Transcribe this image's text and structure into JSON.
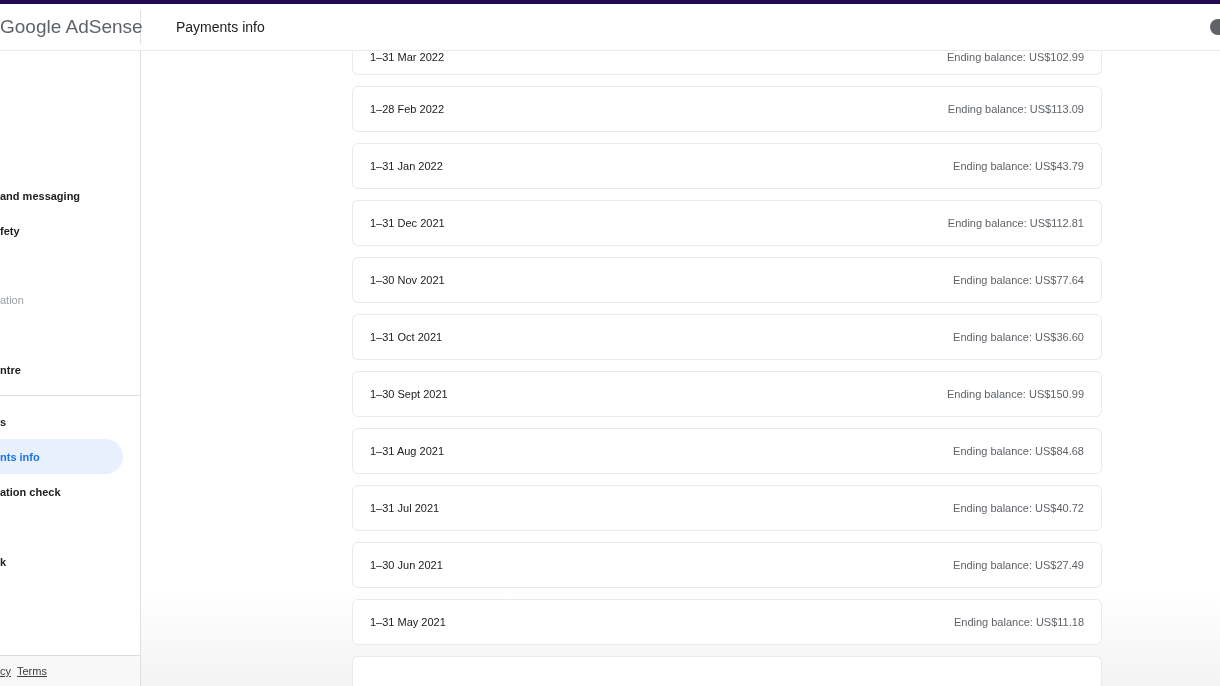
{
  "header": {
    "logo": "Google AdSense",
    "title": "Payments info"
  },
  "sidebar": {
    "groups": [
      {
        "items": [
          {
            "label": "and messaging",
            "kind": "link",
            "selected": false
          },
          {
            "label": "fety",
            "kind": "link",
            "selected": false
          },
          {
            "label": "ation",
            "kind": "heading",
            "selected": false
          },
          {
            "label": "ntre",
            "kind": "link",
            "selected": false
          }
        ]
      },
      {
        "items": [
          {
            "label": "s",
            "kind": "link",
            "selected": false
          },
          {
            "label": "nts info",
            "kind": "link",
            "selected": true
          },
          {
            "label": "ation check",
            "kind": "link",
            "selected": false
          },
          {
            "label": "k",
            "kind": "link",
            "selected": false
          }
        ]
      }
    ],
    "footer": [
      "cy",
      "Terms"
    ]
  },
  "statements": [
    {
      "period": "1–31 Mar 2022",
      "balance": "Ending balance: US$102.99"
    },
    {
      "period": "1–28 Feb 2022",
      "balance": "Ending balance: US$113.09"
    },
    {
      "period": "1–31 Jan 2022",
      "balance": "Ending balance: US$43.79"
    },
    {
      "period": "1–31 Dec 2021",
      "balance": "Ending balance: US$112.81"
    },
    {
      "period": "1–30 Nov 2021",
      "balance": "Ending balance: US$77.64"
    },
    {
      "period": "1–31 Oct 2021",
      "balance": "Ending balance: US$36.60"
    },
    {
      "period": "1–30 Sept 2021",
      "balance": "Ending balance: US$150.99"
    },
    {
      "period": "1–31 Aug 2021",
      "balance": "Ending balance: US$84.68"
    },
    {
      "period": "1–31 Jul 2021",
      "balance": "Ending balance: US$40.72"
    },
    {
      "period": "1–30 Jun 2021",
      "balance": "Ending balance: US$27.49"
    },
    {
      "period": "1–31 May 2021",
      "balance": "Ending balance: US$11.18"
    }
  ]
}
